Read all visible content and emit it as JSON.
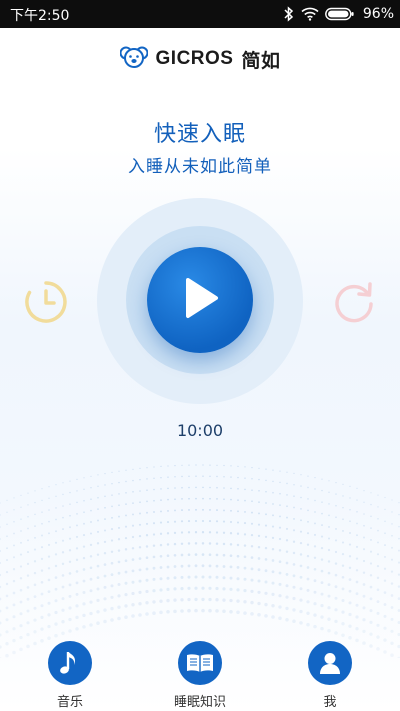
{
  "status_bar": {
    "time": "下午2:50",
    "battery": "96%",
    "icons": [
      "bluetooth-icon",
      "wifi-icon",
      "battery-icon"
    ]
  },
  "header": {
    "brand": "GICROS",
    "brand_cn": "简如",
    "logo_icon": "koala-logo-icon"
  },
  "main": {
    "title": "快速入眠",
    "subtitle": "入睡从未如此简单",
    "timer": "10:00",
    "left_control_icon": "clock-icon",
    "right_control_icon": "repeat-icon",
    "center_control_icon": "play-icon"
  },
  "tabs": [
    {
      "label": "音乐",
      "icon": "music-note-icon"
    },
    {
      "label": "睡眠知识",
      "icon": "book-icon"
    },
    {
      "label": "我",
      "icon": "user-icon"
    }
  ],
  "colors": {
    "accent": "#1265c4",
    "title": "#1360bb",
    "clock_icon": "#f1dc9b",
    "repeat_icon": "#f5cfd3",
    "ring_outer": "#e3eef9",
    "ring_mid": "#c9dff3"
  }
}
